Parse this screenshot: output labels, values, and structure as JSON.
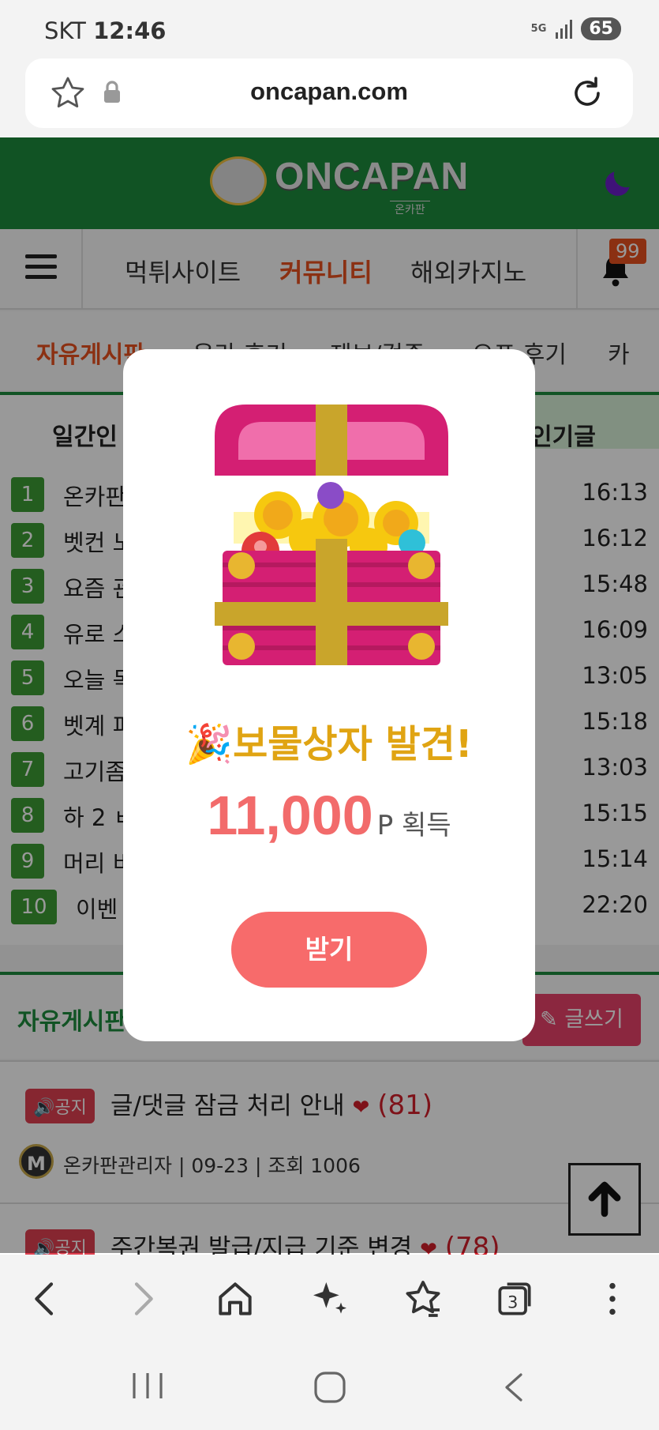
{
  "status_bar": {
    "carrier": "SKT",
    "time": "12:46",
    "network": "5G",
    "battery": "65"
  },
  "browser": {
    "url": "oncapan.com"
  },
  "site": {
    "logo_text": "ONCAPAN",
    "logo_sub": "온카판",
    "main_nav": [
      "먹튀사이트",
      "커뮤니티",
      "해외카지노"
    ],
    "notification_count": "99",
    "sub_nav": [
      "자유게시판",
      "온라 후기",
      "제보/검증",
      "으프 후기",
      "카"
    ]
  },
  "popular": {
    "tab_left": "일간인",
    "tab_right": "인기글",
    "rows": [
      {
        "rank": "1",
        "title": "온카판",
        "time": "16:13"
      },
      {
        "rank": "2",
        "title": "벳컨 노",
        "time": "16:12"
      },
      {
        "rank": "3",
        "title": "요즘 관",
        "time": "15:48"
      },
      {
        "rank": "4",
        "title": "유로 스",
        "time": "16:09"
      },
      {
        "rank": "5",
        "title": "오늘 독",
        "time": "13:05"
      },
      {
        "rank": "6",
        "title": "벳계 피",
        "time": "15:18"
      },
      {
        "rank": "7",
        "title": "고기좀",
        "time": "13:03"
      },
      {
        "rank": "8",
        "title": "하 2 ㅂ",
        "time": "15:15"
      },
      {
        "rank": "9",
        "title": "머리 비",
        "time": "15:14"
      },
      {
        "rank": "10",
        "title": "이벤",
        "time": "22:20"
      }
    ]
  },
  "board": {
    "title": "자유게시판",
    "write_label": "글쓰기",
    "posts": [
      {
        "badge": "공지",
        "title": "글/댓글 잠금 처리 안내",
        "count": "(81)",
        "author": "온카판관리자",
        "date": "09-23",
        "views": "조회 1006"
      },
      {
        "badge": "공지",
        "title": "주간복권 발급/지급 기준 변경",
        "count": "(78)"
      }
    ]
  },
  "modal": {
    "emoji": "🎉",
    "title": "보물상자 발견!",
    "amount": "11,000",
    "unit": "P 획득",
    "button": "받기"
  },
  "colors": {
    "brand_green": "#1d8a3c",
    "accent_orange": "#e8501e",
    "modal_title": "#e0a413",
    "amount": "#f26b6b",
    "button": "#f76b6b"
  }
}
